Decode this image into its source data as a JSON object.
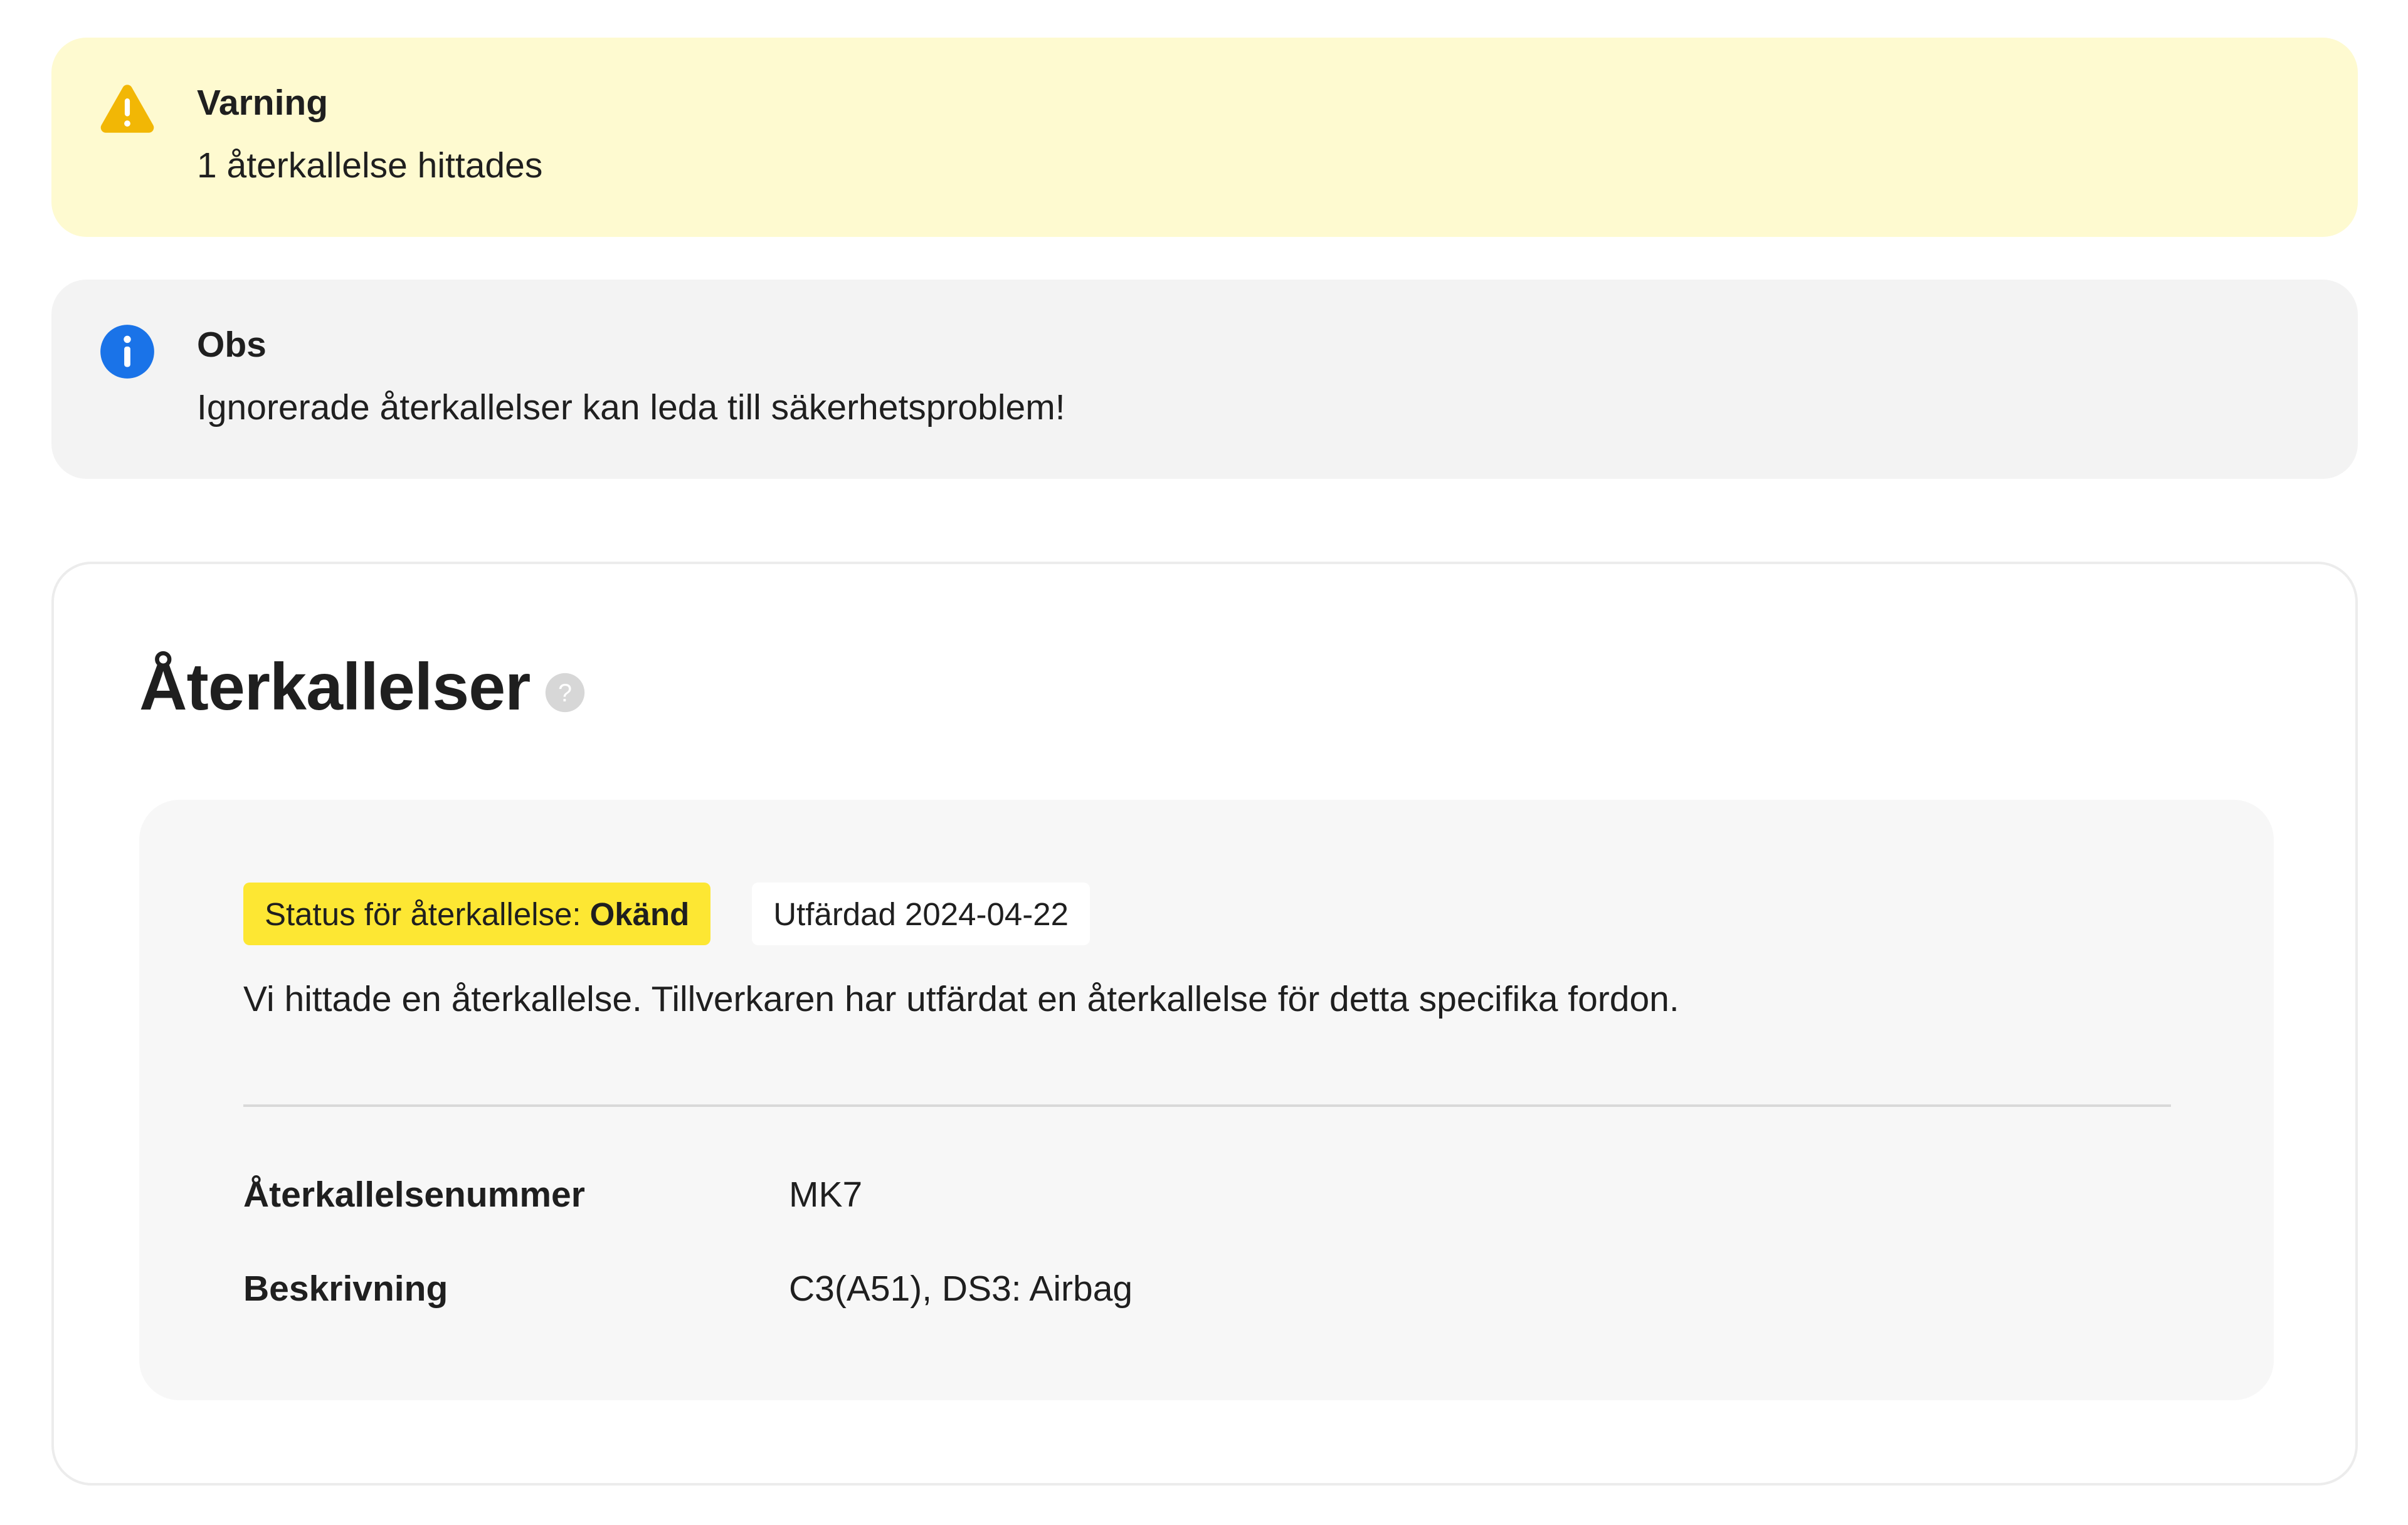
{
  "alerts": {
    "warning": {
      "icon": "warning-triangle-icon",
      "title": "Varning",
      "text": "1 återkallelse hittades",
      "color": "#fefad0",
      "icon_color": "#f2b705"
    },
    "info": {
      "icon": "info-circle-icon",
      "title": "Obs",
      "text": "Ignorerade återkallelser kan leda till säkerhetsproblem!",
      "color": "#f3f3f3",
      "icon_color": "#1a73e8"
    }
  },
  "recalls": {
    "title": "Återkallelser",
    "help_icon": "help-circle-icon",
    "item": {
      "status_label": "Status för återkallelse:",
      "status_value": "Okänd",
      "status_color": "#fde733",
      "issued": "Utfärdad 2024-04-22",
      "description": "Vi hittade en återkallelse. Tillverkaren har utfärdat en återkallelse för detta specifika fordon.",
      "details": [
        {
          "label": "Återkallelsenummer",
          "value": "MK7"
        },
        {
          "label": "Beskrivning",
          "value": "C3(A51), DS3: Airbag"
        }
      ]
    }
  }
}
